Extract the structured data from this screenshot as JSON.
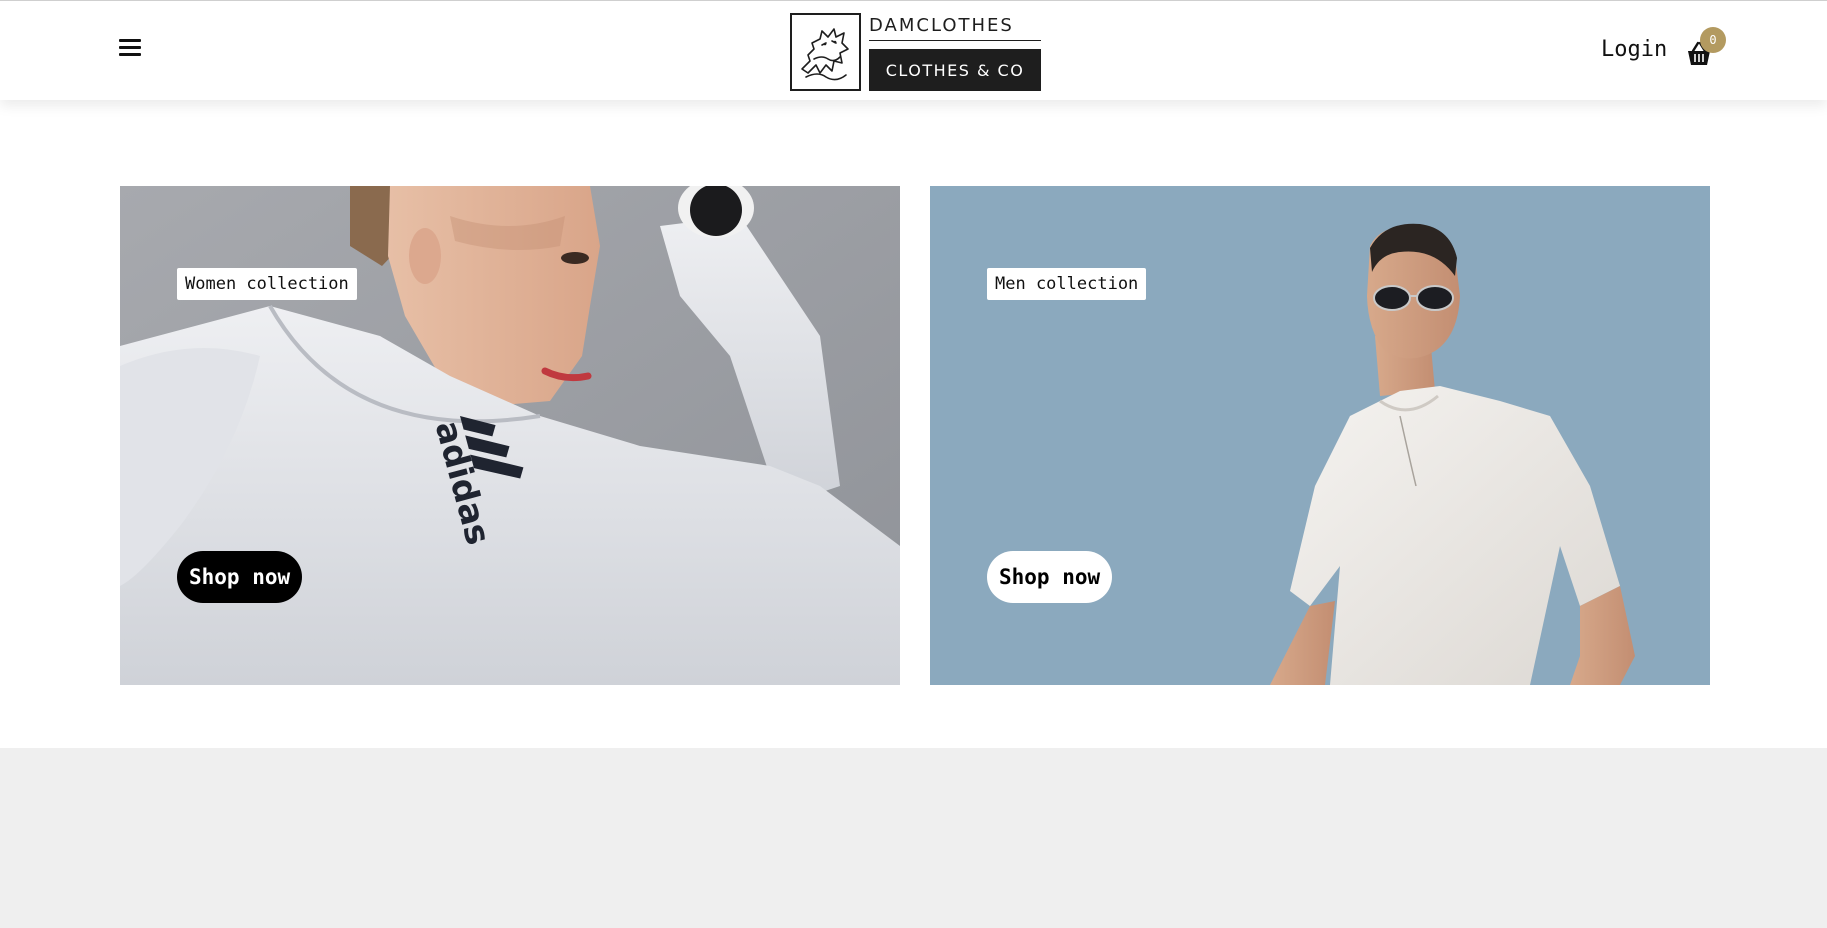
{
  "header": {
    "menu_icon": "hamburger-menu-icon",
    "logo": {
      "top": "DAMCLOTHES",
      "bottom": "CLOTHES & CO",
      "emblem_icon": "wolf-emblem"
    },
    "login_label": "Login",
    "cart": {
      "icon": "basket-icon",
      "count": "0"
    }
  },
  "collections": [
    {
      "label": "Women collection",
      "button": "Shop now",
      "button_style": "dark"
    },
    {
      "label": "Men collection",
      "button": "Shop now",
      "button_style": "light"
    }
  ],
  "colors": {
    "accent": "#b39a60",
    "men_card_bg": "#8ba9be",
    "footer_bg": "#efefef",
    "logo_dark": "#1e1e1e"
  }
}
